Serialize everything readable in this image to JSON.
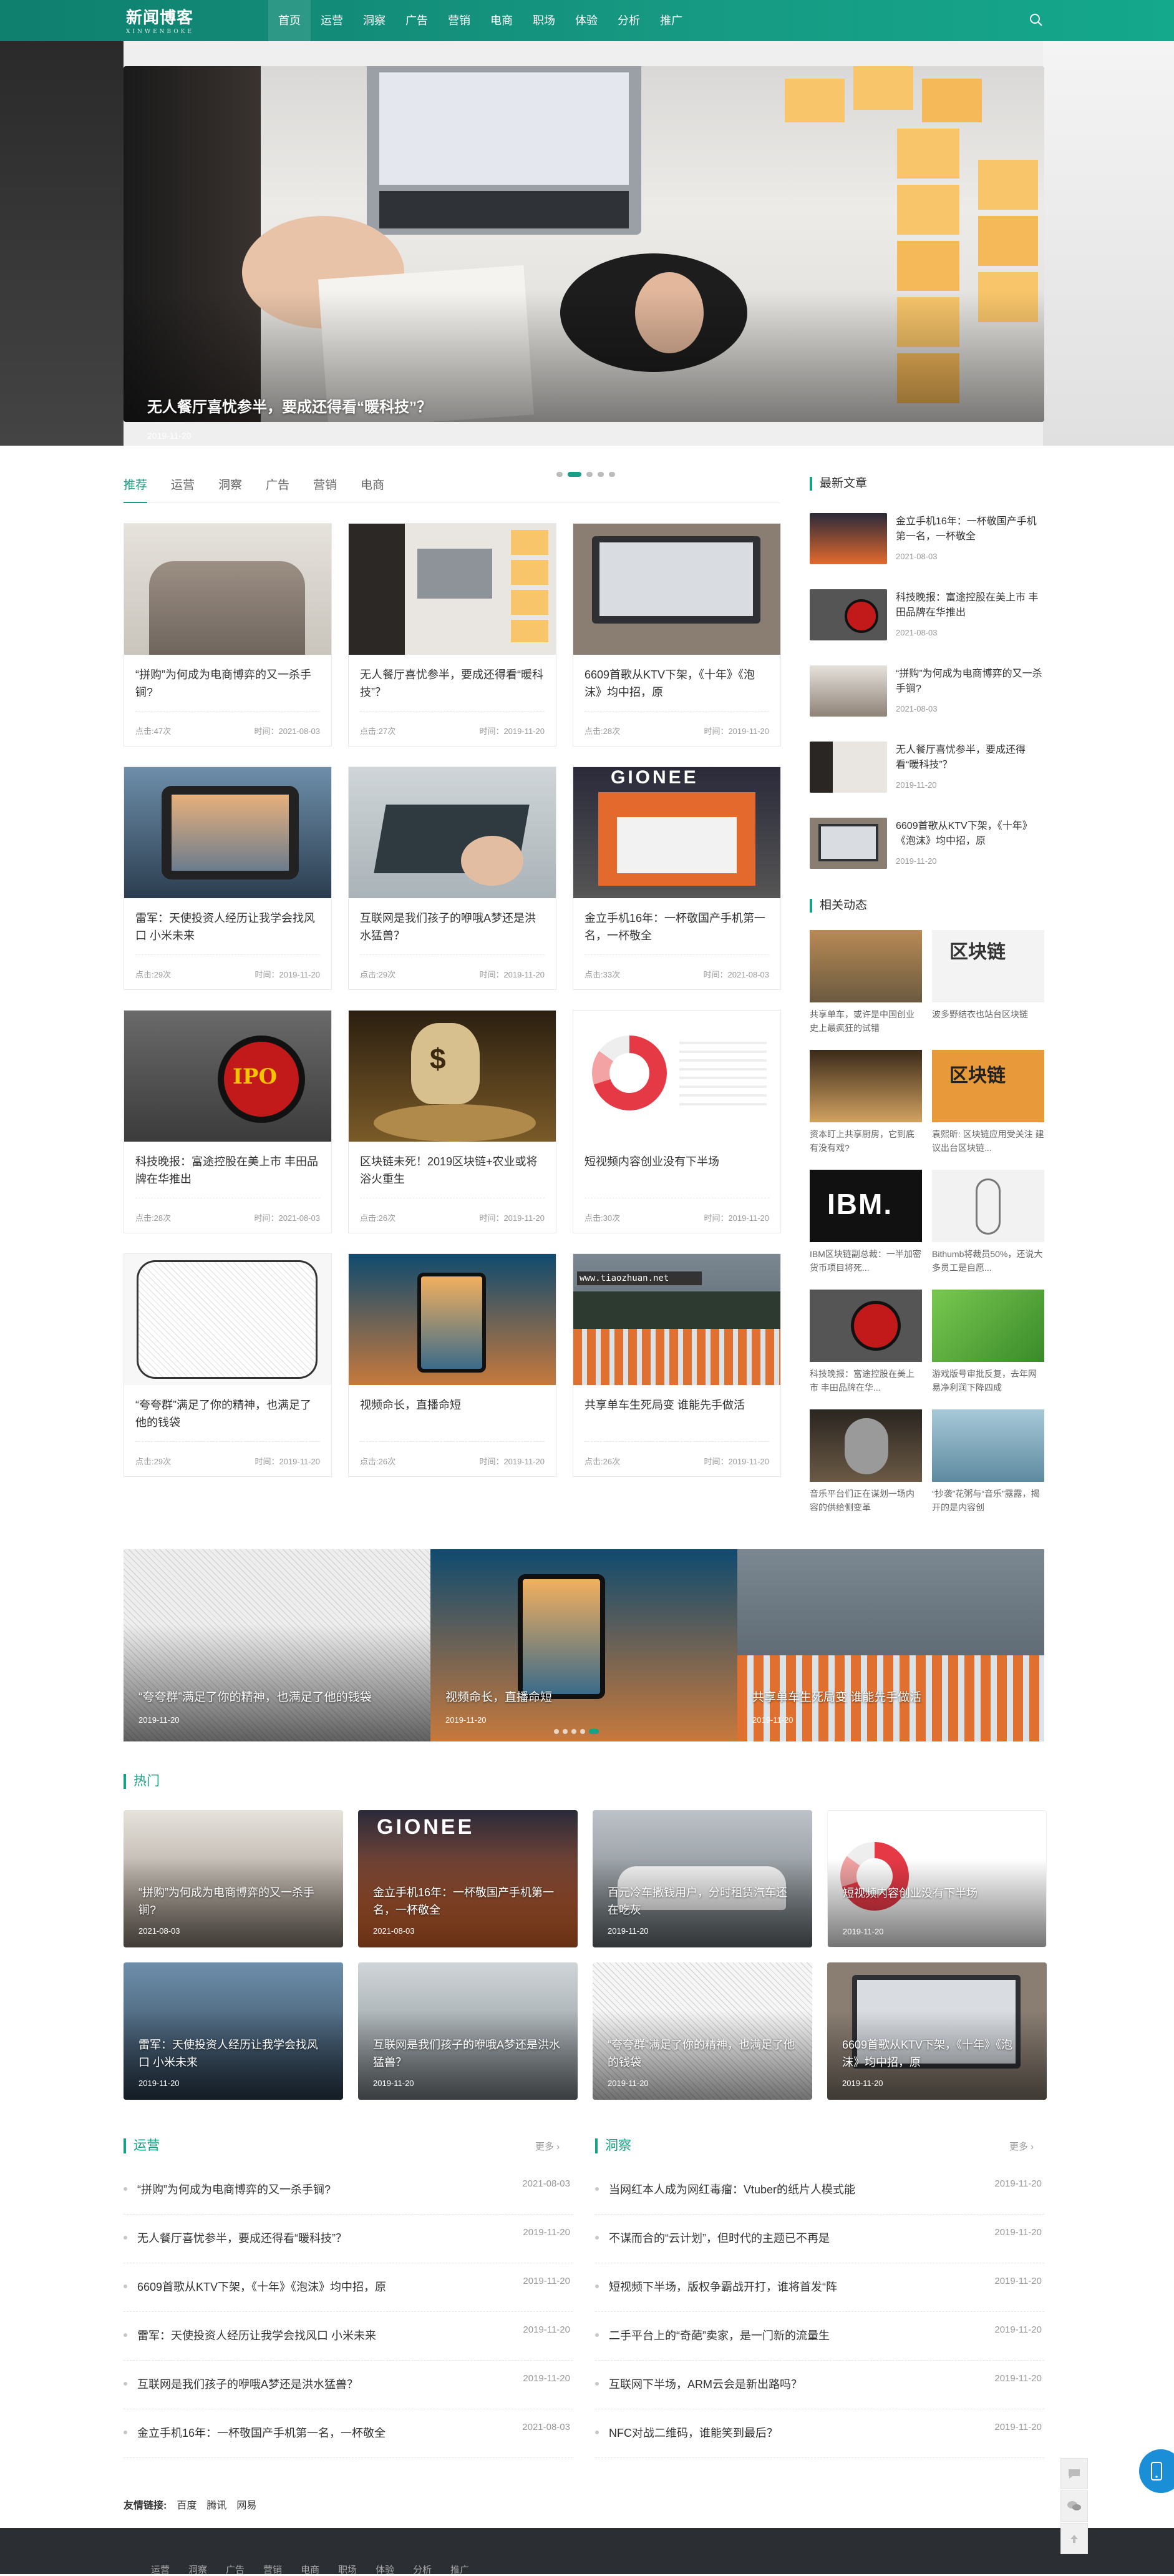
{
  "header": {
    "logo_title": "新闻博客",
    "logo_sub": "XINWENBOKE",
    "nav": [
      "首页",
      "运营",
      "洞察",
      "广告",
      "营销",
      "电商",
      "职场",
      "体验",
      "分析",
      "推广"
    ]
  },
  "hero": {
    "caption": "无人餐厅喜忧参半，要成还得看“暖科技”？",
    "date": "2019-11-20"
  },
  "tabs": [
    "推荐",
    "运营",
    "洞察",
    "广告",
    "营销",
    "电商"
  ],
  "cards": [
    {
      "title": "“拼购”为何成为电商博弈的又一杀手锏?",
      "views": "点击:47次",
      "time": "时间：2021-08-03"
    },
    {
      "title": "无人餐厅喜忧参半，要成还得看“暖科技”？",
      "views": "点击:27次",
      "time": "时间：2019-11-20"
    },
    {
      "title": "6609首歌从KTV下架，《十年》《泡沫》均中招，原",
      "views": "点击:28次",
      "time": "时间：2019-11-20"
    },
    {
      "title": "雷军：天使投资人经历让我学会找风口 小米未来",
      "views": "点击:29次",
      "time": "时间：2019-11-20"
    },
    {
      "title": "互联网是我们孩子的咿哦A梦还是洪水猛兽？",
      "views": "点击:29次",
      "time": "时间：2019-11-20"
    },
    {
      "title": "金立手机16年：一杯敬国产手机第一名，一杯敬全",
      "views": "点击:33次",
      "time": "时间：2021-08-03"
    },
    {
      "title": "科技晚报：富途控股在美上市 丰田品牌在华推出",
      "views": "点击:28次",
      "time": "时间：2021-08-03"
    },
    {
      "title": "区块链未死！2019区块链+农业或将浴火重生",
      "views": "点击:26次",
      "time": "时间：2019-11-20"
    },
    {
      "title": "短视频内容创业没有下半场",
      "views": "点击:30次",
      "time": "时间：2019-11-20"
    },
    {
      "title": "“夸夸群”满足了你的精神，也满足了他的钱袋",
      "views": "点击:29次",
      "time": "时间：2019-11-20"
    },
    {
      "title": "视频命长，直播命短",
      "views": "点击:26次",
      "time": "时间：2019-11-20"
    },
    {
      "title": "共享单车生死局变 谁能先手做活",
      "views": "点击:26次",
      "time": "时间：2019-11-20"
    }
  ],
  "sidebar": {
    "latest_title": "最新文章",
    "latest": [
      {
        "title": "金立手机16年：一杯敬国产手机第一名，一杯敬全",
        "date": "2021-08-03"
      },
      {
        "title": "科技晚报：富途控股在美上市 丰田品牌在华推出",
        "date": "2021-08-03"
      },
      {
        "title": "“拼购”为何成为电商博弈的又一杀手锏?",
        "date": "2021-08-03"
      },
      {
        "title": "无人餐厅喜忧参半，要成还得看“暖科技”？",
        "date": "2019-11-20"
      },
      {
        "title": "6609首歌从KTV下架，《十年》《泡沫》均中招，原",
        "date": "2019-11-20"
      }
    ],
    "related_title": "相关动态",
    "related": [
      "共享单车，或许是中国创业史上最疯狂的试错",
      "波多野结衣也站台区块链",
      "资本盯上共享厨房，它到底有没有戏?",
      "袁熙昕: 区块链应用受关注 建议出台区块链...",
      "IBM区块链副总裁：一半加密货币项目将死...",
      "Bithumb将裁员50%，还说大多员工是自愿...",
      "科技晚报：富途控股在美上市 丰田品牌在华...",
      "游戏版号审批反复，去年网易净利润下降四成",
      "音乐平台们正在谋划一场内容的供给侧变革",
      "“抄袭”花粥与“音乐”露露，揭开的是内容创"
    ]
  },
  "slider2": [
    {
      "caption": "“夸夸群”满足了你的精神，也满足了他的钱袋",
      "date": "2019-11-20"
    },
    {
      "caption": "视频命长，直播命短",
      "date": "2019-11-20"
    },
    {
      "caption": "共享单车生死局变 谁能先手做活",
      "date": "2019-11-20"
    }
  ],
  "hot": {
    "title": "热门",
    "items": [
      {
        "caption": "“拼购”为何成为电商博弈的又一杀手锏?",
        "date": "2021-08-03"
      },
      {
        "caption": "金立手机16年：一杯敬国产手机第一名，一杯敬全",
        "date": "2021-08-03"
      },
      {
        "caption": "百元冷车撒钱用户，分时租赁汽车还在吃灰",
        "date": "2019-11-20"
      },
      {
        "caption": "短视频内容创业没有下半场",
        "date": "2019-11-20"
      },
      {
        "caption": "雷军：天使投资人经历让我学会找风口 小米未来",
        "date": "2019-11-20"
      },
      {
        "caption": "互联网是我们孩子的咿哦A梦还是洪水猛兽？",
        "date": "2019-11-20"
      },
      {
        "caption": "“夸夸群”满足了你的精神，也满足了他的钱袋",
        "date": "2019-11-20"
      },
      {
        "caption": "6609首歌从KTV下架，《十年》《泡沫》均中招，原",
        "date": "2019-11-20"
      }
    ]
  },
  "yunying": {
    "title": "运营",
    "more": "更多 ›",
    "rows": [
      {
        "title": "“拼购”为何成为电商博弈的又一杀手锏?",
        "date": "2021-08-03"
      },
      {
        "title": "无人餐厅喜忧参半，要成还得看“暖科技”？",
        "date": "2019-11-20"
      },
      {
        "title": "6609首歌从KTV下架，《十年》《泡沫》均中招，原",
        "date": "2019-11-20"
      },
      {
        "title": "雷军：天使投资人经历让我学会找风口 小米未来",
        "date": "2019-11-20"
      },
      {
        "title": "互联网是我们孩子的咿哦A梦还是洪水猛兽？",
        "date": "2019-11-20"
      },
      {
        "title": "金立手机16年：一杯敬国产手机第一名，一杯敬全",
        "date": "2021-08-03"
      }
    ]
  },
  "dongcha": {
    "title": "洞察",
    "more": "更多 ›",
    "rows": [
      {
        "title": "当网红本人成为网红毒瘤：Vtuber的纸片人模式能",
        "date": "2019-11-20"
      },
      {
        "title": "不谋而合的“云计划”，但时代的主题已不再是",
        "date": "2019-11-20"
      },
      {
        "title": "短视频下半场，版权争霸战开打，谁将首发“阵",
        "date": "2019-11-20"
      },
      {
        "title": "二手平台上的“奇葩”卖家，是一门新的流量生",
        "date": "2019-11-20"
      },
      {
        "title": "互联网下半场，ARM云会是新出路吗？",
        "date": "2019-11-20"
      },
      {
        "title": "NFC对战二维码，谁能笑到最后？",
        "date": "2019-11-20"
      }
    ]
  },
  "links": {
    "label": "友情链接:",
    "items": [
      "百度",
      "腾讯",
      "网易"
    ]
  },
  "footer": {
    "nav": [
      "运营",
      "洞察",
      "广告",
      "营销",
      "电商",
      "职场",
      "体验",
      "分析",
      "推广"
    ]
  },
  "watermark": "www.tiaozhuan.net"
}
